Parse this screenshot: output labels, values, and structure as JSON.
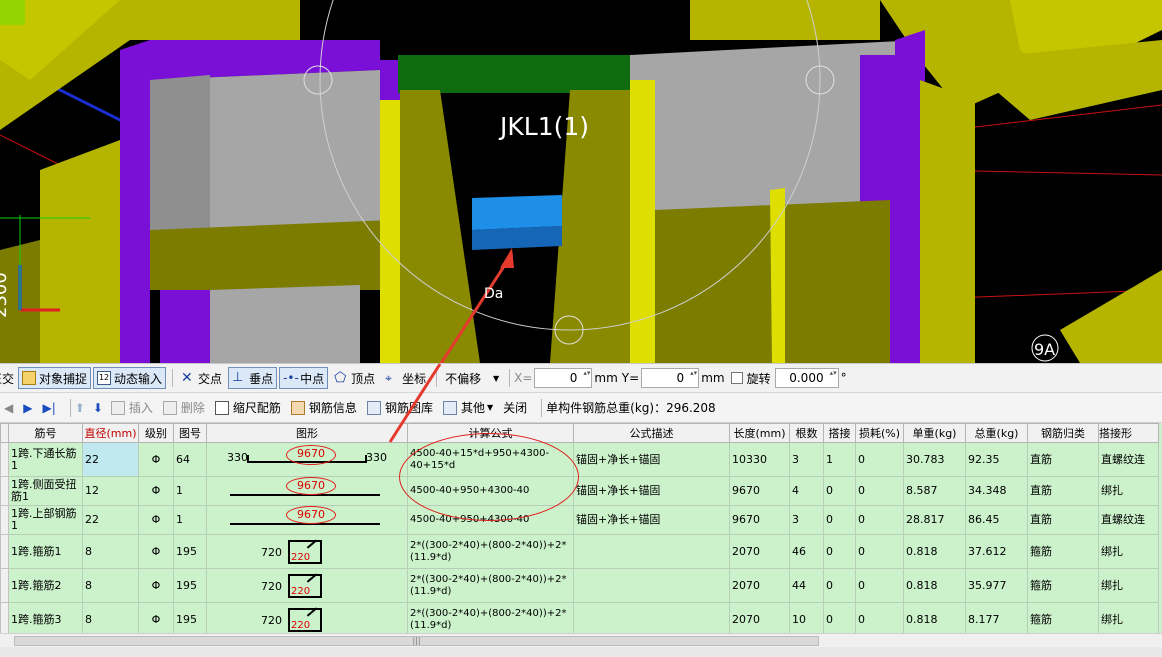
{
  "viewport": {
    "beam_label": "JKL1(1)",
    "side_label": "2300",
    "marker_label": "9A",
    "small_label": "Da"
  },
  "snapbar": {
    "left_cut": "正交",
    "object_snap": "对象捕捉",
    "dynamic_input": "动态输入",
    "intersection": "交点",
    "perpendicular": "垂点",
    "midpoint": "中点",
    "vertex": "顶点",
    "coordinate": "坐标",
    "offset_mode": "不偏移",
    "x_label": "X=",
    "x_value": "0",
    "x_unit": "mm",
    "y_label": "Y=",
    "y_value": "0",
    "y_unit": "mm",
    "rotate_label": "旋转",
    "rotate_value": "0.000",
    "degree": "°"
  },
  "gridbar": {
    "insert": "插入",
    "delete": "删除",
    "scale_rebar": "缩尺配筋",
    "rebar_info": "钢筋信息",
    "rebar_library": "钢筋图库",
    "other": "其他",
    "close": "关闭",
    "total_weight": "单构件钢筋总重(kg)：296.208"
  },
  "table": {
    "headers": [
      "筋号",
      "直径(mm)",
      "级别",
      "图号",
      "图形",
      "计算公式",
      "公式描述",
      "长度(mm)",
      "根数",
      "搭接",
      "损耗(%)",
      "单重(kg)",
      "总重(kg)",
      "钢筋归类",
      "搭接形"
    ],
    "rows": [
      {
        "name": "1跨.下通长筋1",
        "dia": "22",
        "grade": "Φ",
        "fig": "64",
        "left": "330",
        "mid": "9670",
        "right": "330",
        "formula": "4500-40+15*d+950+4300-40+15*d",
        "desc": "锚固+净长+锚固",
        "len": "10330",
        "count": "3",
        "lap": "1",
        "loss": "0",
        "unit": "30.783",
        "total": "92.35",
        "cat": "直筋",
        "laptype": "直螺纹连"
      },
      {
        "name": "1跨.侧面受扭筋1",
        "dia": "12",
        "grade": "Φ",
        "fig": "1",
        "left": "",
        "mid": "9670",
        "right": "",
        "formula": "4500-40+950+4300-40",
        "desc": "锚固+净长+锚固",
        "len": "9670",
        "count": "4",
        "lap": "0",
        "loss": "0",
        "unit": "8.587",
        "total": "34.348",
        "cat": "直筋",
        "laptype": "绑扎"
      },
      {
        "name": "1跨.上部钢筋1",
        "dia": "22",
        "grade": "Φ",
        "fig": "1",
        "left": "",
        "mid": "9670",
        "right": "",
        "formula": "4500-40+950+4300-40",
        "desc": "锚固+净长+锚固",
        "len": "9670",
        "count": "3",
        "lap": "0",
        "loss": "0",
        "unit": "28.817",
        "total": "86.45",
        "cat": "直筋",
        "laptype": "直螺纹连"
      },
      {
        "name": "1跨.箍筋1",
        "dia": "8",
        "grade": "Φ",
        "fig": "195",
        "left": "720",
        "mid": "220",
        "right": "",
        "formula": "2*((300-2*40)+(800-2*40))+2*(11.9*d)",
        "desc": "",
        "len": "2070",
        "count": "46",
        "lap": "0",
        "loss": "0",
        "unit": "0.818",
        "total": "37.612",
        "cat": "箍筋",
        "laptype": "绑扎"
      },
      {
        "name": "1跨.箍筋2",
        "dia": "8",
        "grade": "Φ",
        "fig": "195",
        "left": "720",
        "mid": "220",
        "right": "",
        "formula": "2*((300-2*40)+(800-2*40))+2*(11.9*d)",
        "desc": "",
        "len": "2070",
        "count": "44",
        "lap": "0",
        "loss": "0",
        "unit": "0.818",
        "total": "35.977",
        "cat": "箍筋",
        "laptype": "绑扎"
      },
      {
        "name": "1跨.箍筋3",
        "dia": "8",
        "grade": "Φ",
        "fig": "195",
        "left": "720",
        "mid": "220",
        "right": "",
        "formula": "2*((300-2*40)+(800-2*40))+2*(11.9*d)",
        "desc": "",
        "len": "2070",
        "count": "10",
        "lap": "0",
        "loss": "0",
        "unit": "0.818",
        "total": "8.177",
        "cat": "箍筋",
        "laptype": "绑扎"
      }
    ]
  },
  "colors": {
    "yellow": "#b5b500",
    "purple": "#7a10d8",
    "gray": "#a6a6a6",
    "green": "#0e6b0e",
    "blue_beam": "#1e8fe8",
    "row_bg": "#ccf2cc",
    "annotation_red": "#e53a2e"
  }
}
